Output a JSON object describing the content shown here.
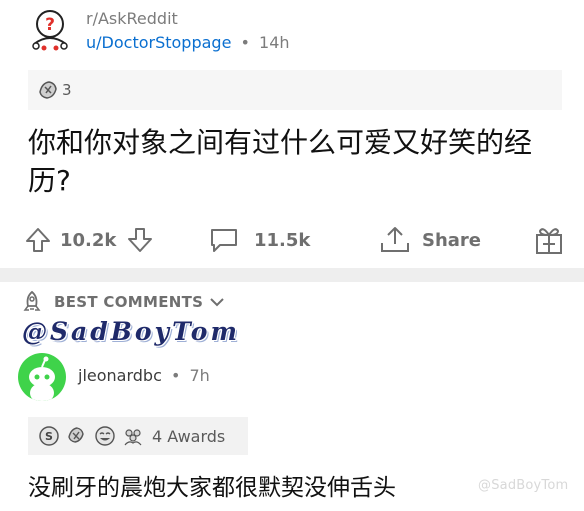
{
  "post": {
    "subreddit": "r/AskReddit",
    "author": "u/DoctorStoppage",
    "separator": "•",
    "age": "14h",
    "award_count": "3",
    "title": "你和你对象之间有过什么可爱又好笑的经历?"
  },
  "actions": {
    "upvotes": "10.2k",
    "comments": "11.5k",
    "share": "Share"
  },
  "sort": {
    "label": "BEST COMMENTS"
  },
  "watermark": {
    "top": "@SadBoyTom",
    "bottom": "@SadBoyTom"
  },
  "comment": {
    "author": "jleonardbc",
    "separator": "•",
    "age": "7h",
    "awards_label": "4 Awards",
    "text": "没刷牙的晨炮大家都很默契没伸舌头"
  },
  "colors": {
    "username_link": "#0a6fd0",
    "muted": "#7c7c7c",
    "avatar_green": "#3fd34a",
    "divider": "#eeeeee"
  }
}
